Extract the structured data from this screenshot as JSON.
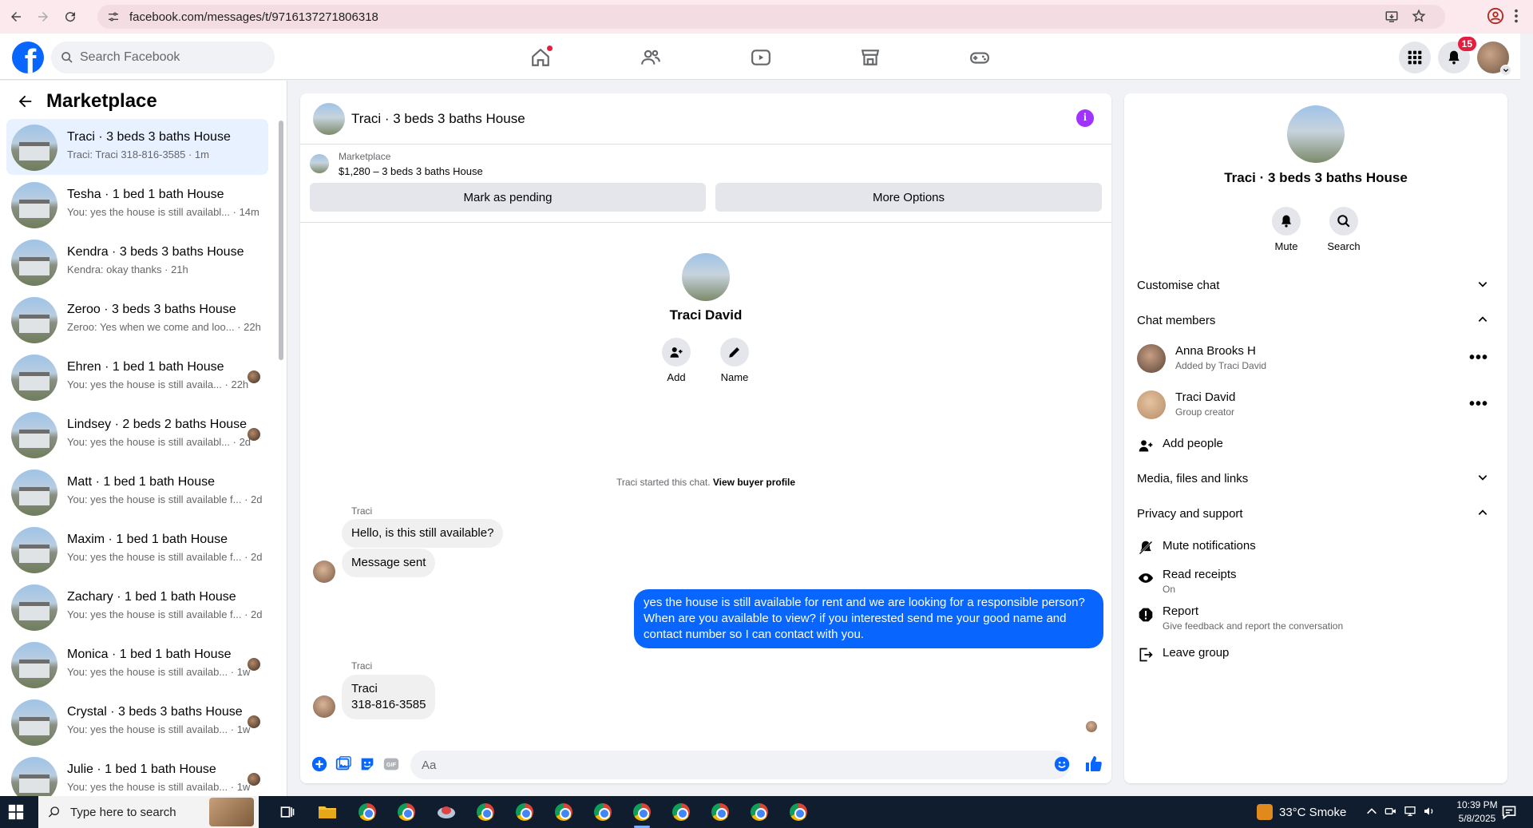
{
  "browser": {
    "url": "facebook.com/messages/t/9716137271806318"
  },
  "header": {
    "search_placeholder": "Search Facebook",
    "notifications_count": "15"
  },
  "sidebar": {
    "title": "Marketplace",
    "conversations": [
      {
        "title": "Traci · 3 beds 3 baths House",
        "snippet": "Traci: Traci 318-816-3585 · 1m",
        "active": true
      },
      {
        "title": "Tesha · 1 bed 1 bath House",
        "snippet": "You: yes the house is still availabl... · 14m"
      },
      {
        "title": "Kendra · 3 beds 3 baths House",
        "snippet": "Kendra: okay thanks · 21h"
      },
      {
        "title": "Zeroo · 3 beds 3 baths House",
        "snippet": "Zeroo: Yes when we come and loo... · 22h"
      },
      {
        "title": "Ehren · 1 bed 1 bath House",
        "snippet": "You: yes the house is still availa... · 22h"
      },
      {
        "title": "Lindsey · 2 beds 2 baths House",
        "snippet": "You: yes the house is still availabl... · 2d"
      },
      {
        "title": "Matt · 1 bed 1 bath House",
        "snippet": "You: yes the house is still available f... · 2d"
      },
      {
        "title": "Maxim · 1 bed 1 bath House",
        "snippet": "You: yes the house is still available f... · 2d"
      },
      {
        "title": "Zachary · 1 bed 1 bath House",
        "snippet": "You: yes the house is still available f... · 2d"
      },
      {
        "title": "Monica · 1 bed 1 bath House",
        "snippet": "You: yes the house is still availab... · 1w"
      },
      {
        "title": "Crystal · 3 beds 3 baths House",
        "snippet": "You: yes the house is still availab... · 1w"
      },
      {
        "title": "Julie · 1 bed 1 bath House",
        "snippet": "You: yes the house is still availab... · 1w"
      }
    ]
  },
  "chat": {
    "title": "Traci · 3 beds 3 baths House",
    "listing_source": "Marketplace",
    "listing_price": "$1,280 – 3 beds 3 baths House",
    "mark_pending": "Mark as pending",
    "more_options": "More Options",
    "intro_name": "Traci David",
    "add_label": "Add",
    "name_label": "Name",
    "started_text": "Traci started this chat.",
    "view_profile": "View buyer profile",
    "messages": {
      "sender1": "Traci",
      "msg1": "Hello, is this still available?",
      "msg2": "Message sent",
      "msg3_line1": "yes the house is still available for rent and we are looking for a responsible person?",
      "msg3_line2": "When are you available to view? if you interested send me your good name and",
      "msg3_line3": "contact number  so I can contact with you.",
      "sender2": "Traci",
      "msg4_line1": "Traci",
      "msg4_line2": "318-816-3585"
    },
    "composer_placeholder": "Aa"
  },
  "right_panel": {
    "name": "Traci · 3 beds 3 baths House",
    "mute_label": "Mute",
    "search_label": "Search",
    "customise_chat": "Customise chat",
    "chat_members": "Chat members",
    "members": [
      {
        "name": "Anna Brooks H",
        "sub": "Added by Traci David"
      },
      {
        "name": "Traci David",
        "sub": "Group creator"
      }
    ],
    "add_people": "Add people",
    "media_files": "Media, files and links",
    "privacy_support": "Privacy and support",
    "mute_notifications": "Mute notifications",
    "read_receipts": "Read receipts",
    "read_receipts_state": "On",
    "report": "Report",
    "report_sub": "Give feedback and report the conversation",
    "leave_group": "Leave group"
  },
  "taskbar": {
    "search_placeholder": "Type here to search",
    "weather": "33°C  Smoke",
    "time": "10:39 PM",
    "date": "5/8/2025"
  },
  "colors": {
    "accent": "#0866ff",
    "info": "#a033ff",
    "badge": "#e41e3f"
  }
}
